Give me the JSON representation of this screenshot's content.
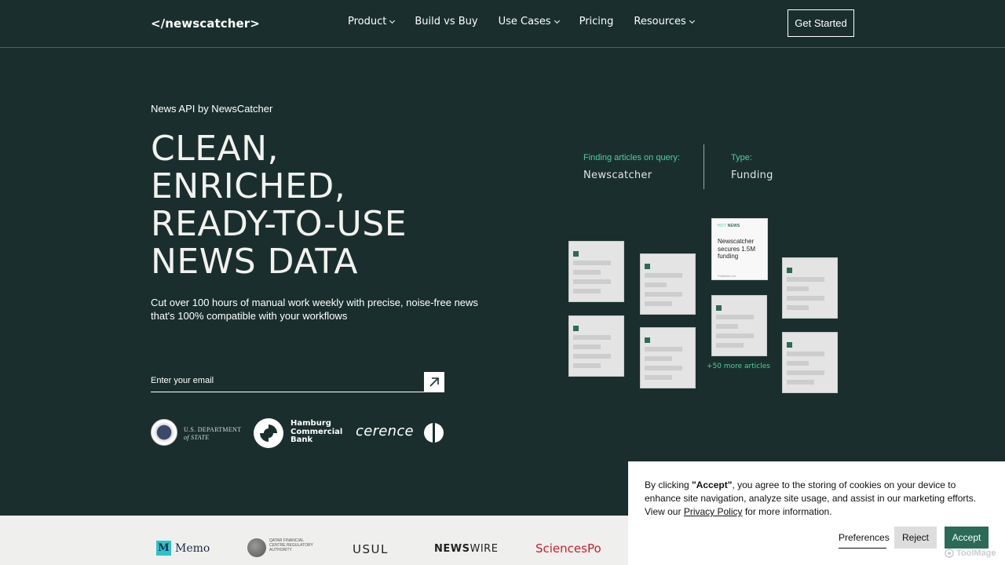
{
  "header": {
    "logo": "</newscatcher>",
    "nav": [
      {
        "label": "Product",
        "has_dropdown": true
      },
      {
        "label": "Build vs Buy",
        "has_dropdown": false
      },
      {
        "label": "Use Cases",
        "has_dropdown": true
      },
      {
        "label": "Pricing",
        "has_dropdown": false
      },
      {
        "label": "Resources",
        "has_dropdown": true
      }
    ],
    "cta_label": "Get Started"
  },
  "hero": {
    "eyebrow": "News API by NewsCatcher",
    "title_lines": [
      "CLEAN,",
      "ENRICHED,",
      "READY-TO-USE",
      "NEWS DATA"
    ],
    "subtitle": "Cut over 100 hours of manual work weekly with precise, noise-free news that's 100% compatible with your workflows",
    "email_placeholder": "Enter your email",
    "submit_icon": "arrow-up-right-icon"
  },
  "trusted_logos": {
    "state_dept": {
      "line1": "U.S. DEPARTMENT",
      "line2": "of STATE"
    },
    "hamburg": {
      "line1": "Hamburg",
      "line2": "Commercial",
      "line3": "Bank"
    },
    "cerence": "cerence"
  },
  "visual": {
    "query_label": "Finding articles on query:",
    "query_value": "Newscatcher",
    "type_label": "Type:",
    "type_value": "Funding",
    "hot_card": {
      "tag_prefix": "HOT",
      "tag": "NEWS",
      "title": "Newscatcher secures 1.5M funding",
      "footer": "Published on"
    },
    "more_articles": "+50 more articles"
  },
  "client_band": {
    "memo": "Memo",
    "memo_mark": "M",
    "qfc": "QATAR FINANCIAL CENTRE REGULATORY AUTHORITY",
    "usul": "USUL",
    "newswire_bold": "NEWS",
    "newswire_rest": "WIRE",
    "sciencespo": "SciencesPo"
  },
  "cookie": {
    "text_before": "By clicking ",
    "text_bold": "\"Accept\"",
    "text_after": ", you agree to the storing of cookies on your device to enhance site navigation, analyze site usage, and assist in our marketing efforts. View our ",
    "policy_link": "Privacy Policy",
    "text_end": " for more information.",
    "preferences_label": "Preferences",
    "reject_label": "Reject",
    "accept_label": "Accept"
  },
  "watermark": "ToolMage",
  "colors": {
    "background": "#1a2f2d",
    "accent": "#4ccf9e",
    "accept_button": "#2a6a57",
    "sciencespo_red": "#c52230"
  }
}
